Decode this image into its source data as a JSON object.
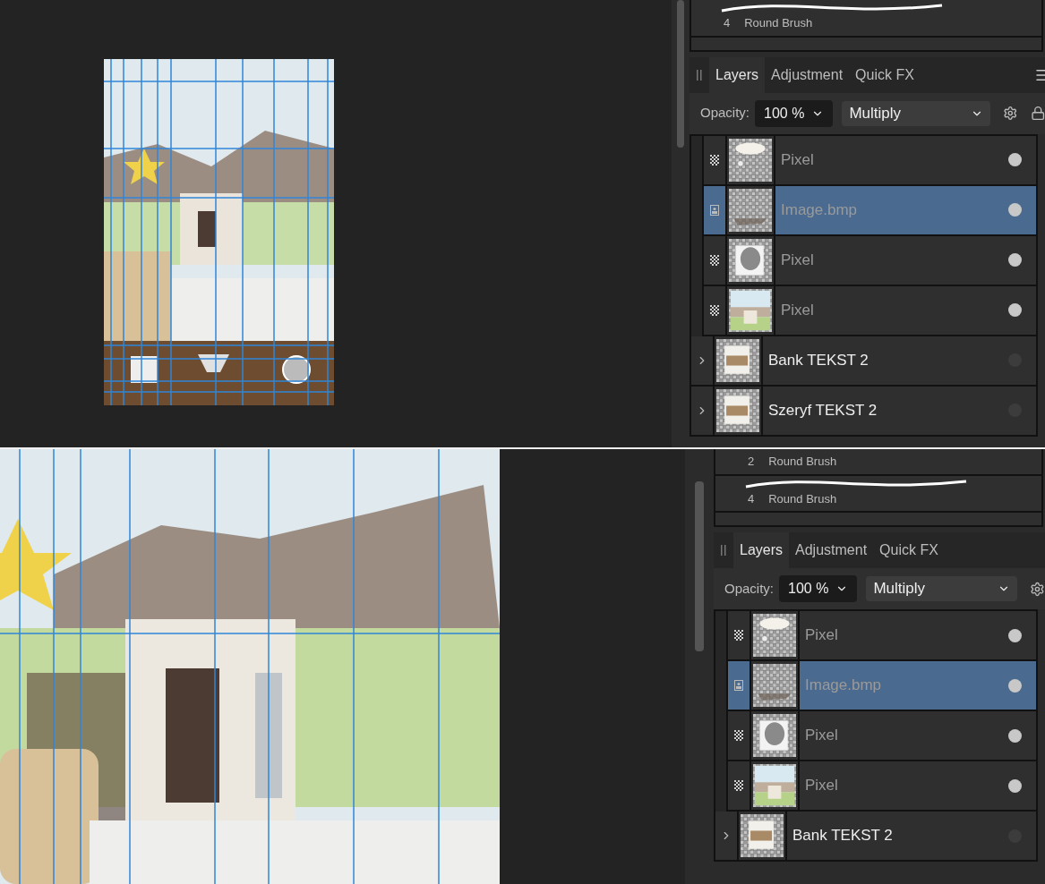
{
  "screens": [
    {
      "brushes": [
        {
          "kind": "stroke",
          "size": "4",
          "name": "Round Brush"
        }
      ],
      "tabs": [
        {
          "label": "Layers",
          "selected": true
        },
        {
          "label": "Adjustment",
          "selected": false
        },
        {
          "label": "Quick FX",
          "selected": false
        }
      ],
      "opacity_label": "Opacity:",
      "opacity": "100 %",
      "blend_mode": "Multiply",
      "layers": [
        {
          "kind": "pixel",
          "name": "Pixel",
          "selected": false,
          "visible": true
        },
        {
          "kind": "image",
          "name": "Image.bmp",
          "selected": true,
          "visible": true
        },
        {
          "kind": "pixel",
          "name": "Pixel",
          "selected": false,
          "visible": true
        },
        {
          "kind": "pixel",
          "name": "Pixel",
          "selected": false,
          "visible": true
        },
        {
          "kind": "group",
          "name": "Bank TEKST 2",
          "selected": false,
          "visible": false
        },
        {
          "kind": "group",
          "name": "Szeryf TEKST 2",
          "selected": false,
          "visible": false
        }
      ]
    },
    {
      "brushes": [
        {
          "kind": "label",
          "size": "2",
          "name": "Round Brush"
        },
        {
          "kind": "stroke",
          "size": "4",
          "name": "Round Brush"
        }
      ],
      "tabs": [
        {
          "label": "Layers",
          "selected": true
        },
        {
          "label": "Adjustment",
          "selected": false
        },
        {
          "label": "Quick FX",
          "selected": false
        }
      ],
      "opacity_label": "Opacity:",
      "opacity": "100 %",
      "blend_mode": "Multiply",
      "layers": [
        {
          "kind": "pixel",
          "name": "Pixel",
          "selected": false,
          "visible": true
        },
        {
          "kind": "image",
          "name": "Image.bmp",
          "selected": true,
          "visible": true
        },
        {
          "kind": "pixel",
          "name": "Pixel",
          "selected": false,
          "visible": true
        },
        {
          "kind": "pixel",
          "name": "Pixel",
          "selected": false,
          "visible": true
        },
        {
          "kind": "group",
          "name": "Bank TEKST 2",
          "selected": false,
          "visible": false
        }
      ]
    }
  ]
}
